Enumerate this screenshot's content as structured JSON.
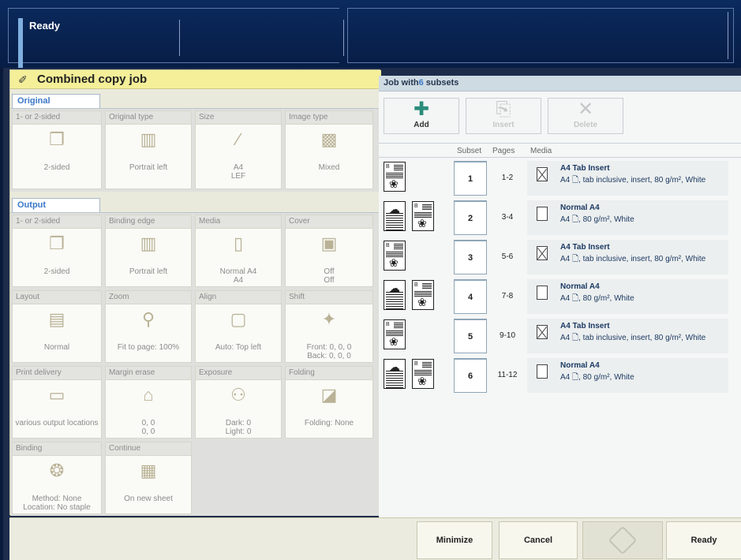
{
  "status": {
    "text": "Ready"
  },
  "job": {
    "title": "Combined copy job"
  },
  "original": {
    "tab": "Original",
    "cells": [
      {
        "label": "1- or 2-sided",
        "icon": "two-sided-icon",
        "value1": "2-sided",
        "value2": ""
      },
      {
        "label": "Original type",
        "icon": "portrait-left-icon",
        "value1": "Portrait left",
        "value2": ""
      },
      {
        "label": "Size",
        "icon": "ruler-icon",
        "value1": "A4",
        "value2": "LEF"
      },
      {
        "label": "Image type",
        "icon": "image-type-icon",
        "value1": "Mixed",
        "value2": ""
      }
    ]
  },
  "output": {
    "tab": "Output",
    "cells": [
      {
        "label": "1- or 2-sided",
        "icon": "two-sided-icon",
        "value1": "2-sided",
        "value2": ""
      },
      {
        "label": "Binding edge",
        "icon": "binding-edge-icon",
        "value1": "Portrait left",
        "value2": ""
      },
      {
        "label": "Media",
        "icon": "media-sheet-icon",
        "value1": "Normal A4",
        "value2": "A4"
      },
      {
        "label": "Cover",
        "icon": "cover-icon",
        "value1": "Off",
        "value2": "Off"
      },
      {
        "label": "Layout",
        "icon": "layout-icon",
        "value1": "Normal",
        "value2": ""
      },
      {
        "label": "Zoom",
        "icon": "magnifier-icon",
        "value1": "Fit to page: 100%",
        "value2": ""
      },
      {
        "label": "Align",
        "icon": "align-icon",
        "value1": "Auto: Top left",
        "value2": ""
      },
      {
        "label": "Shift",
        "icon": "shift-icon",
        "value1": "Front: 0, 0, 0",
        "value2": "Back: 0, 0, 0"
      },
      {
        "label": "Print delivery",
        "icon": "print-delivery-icon",
        "value1": "various output locations",
        "value2": ""
      },
      {
        "label": "Margin erase",
        "icon": "eraser-icon",
        "value1": "0, 0",
        "value2": "0, 0"
      },
      {
        "label": "Exposure",
        "icon": "bulb-icon",
        "value1": "Dark: 0",
        "value2": "Light: 0"
      },
      {
        "label": "Folding",
        "icon": "folding-icon",
        "value1": "Folding: None",
        "value2": ""
      },
      {
        "label": "Binding",
        "icon": "binding-icon",
        "value1": "Method: None",
        "value2": "Location: No staple"
      },
      {
        "label": "Continue",
        "icon": "new-sheet-icon",
        "value1": "On new sheet",
        "value2": ""
      }
    ]
  },
  "subsets": {
    "header_prefix": "Job with",
    "count": "6",
    "header_suffix": " subsets",
    "tools": [
      {
        "label": "Add",
        "icon": "add-icon",
        "enabled": true
      },
      {
        "label": "Insert",
        "icon": "insert-icon",
        "enabled": false
      },
      {
        "label": "Delete",
        "icon": "delete-icon",
        "enabled": false
      }
    ],
    "columns": [
      "Subset",
      "Pages",
      "Media"
    ],
    "rows": [
      {
        "subset": "1",
        "pages": "1-2",
        "tab": true,
        "media_name": "A4 Tab Insert",
        "media_size": "A4",
        "media_desc": ", tab inclusive, insert, 80 g/m², White"
      },
      {
        "subset": "2",
        "pages": "3-4",
        "tab": false,
        "media_name": "Normal A4",
        "media_size": "A4",
        "media_desc": ", 80 g/m², White"
      },
      {
        "subset": "3",
        "pages": "5-6",
        "tab": true,
        "media_name": "A4 Tab Insert",
        "media_size": "A4",
        "media_desc": ", tab inclusive, insert, 80 g/m², White"
      },
      {
        "subset": "4",
        "pages": "7-8",
        "tab": false,
        "media_name": "Normal A4",
        "media_size": "A4",
        "media_desc": ", 80 g/m², White"
      },
      {
        "subset": "5",
        "pages": "9-10",
        "tab": true,
        "media_name": "A4 Tab Insert",
        "media_size": "A4",
        "media_desc": ", tab inclusive, insert, 80 g/m², White"
      },
      {
        "subset": "6",
        "pages": "11-12",
        "tab": false,
        "media_name": "Normal A4",
        "media_size": "A4",
        "media_desc": ", 80 g/m², White"
      }
    ]
  },
  "bottom": {
    "minimize": "Minimize",
    "cancel": "Cancel",
    "ready": "Ready"
  },
  "colors": {
    "accent": "#3b78c8",
    "title_bar": "#f4ef98",
    "add_icon": "#2a8c7a"
  }
}
